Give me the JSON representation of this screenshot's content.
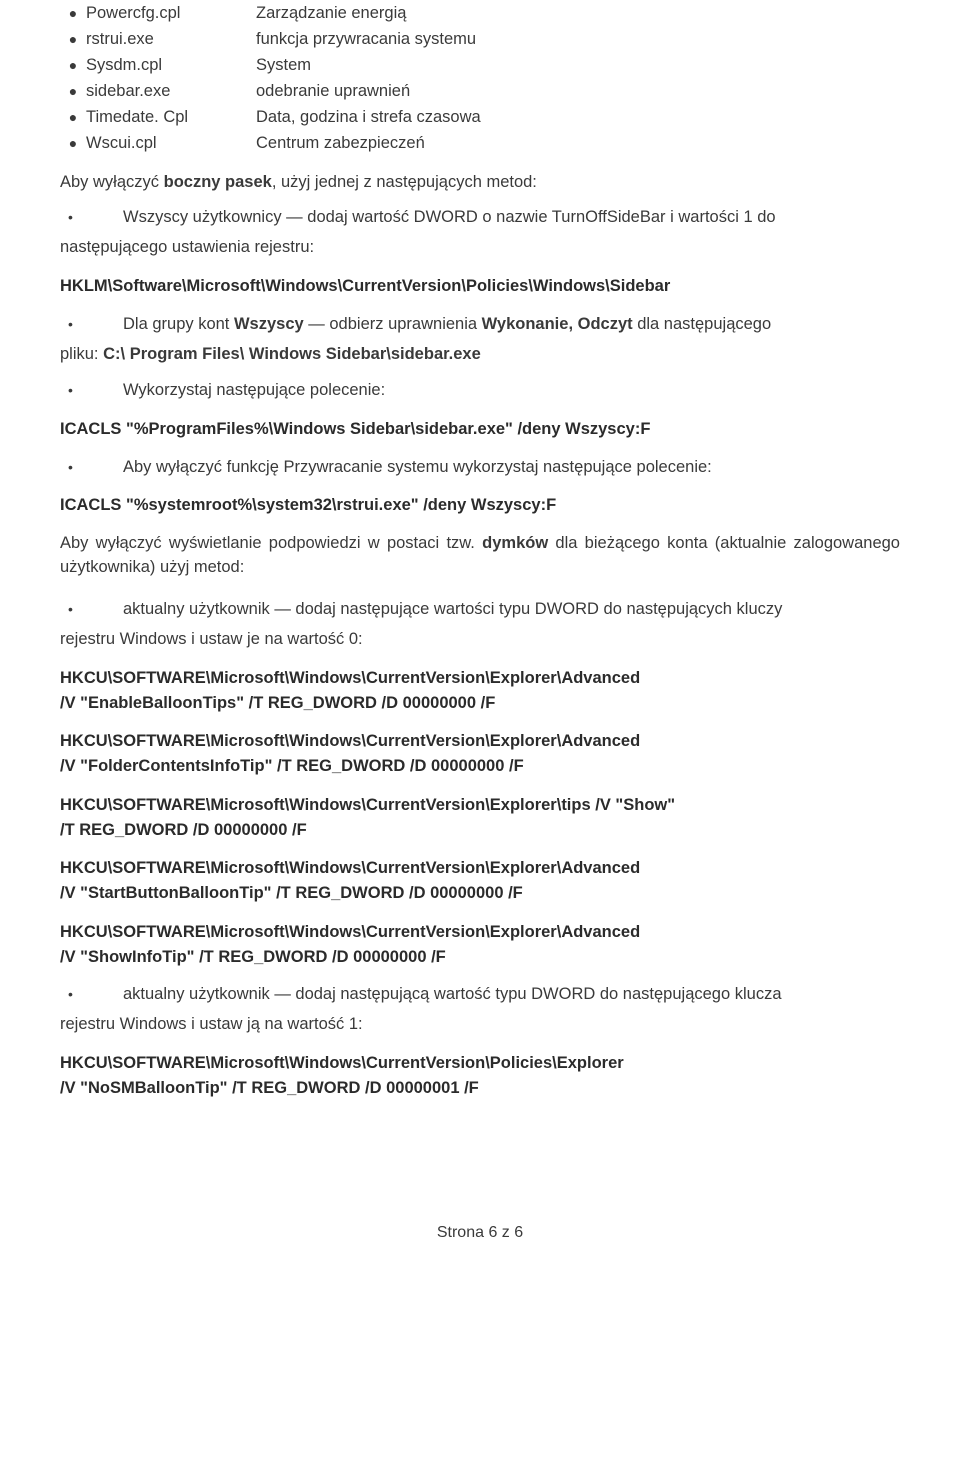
{
  "fileList": [
    {
      "cmd": "Powercfg.cpl",
      "desc": "Zarządzanie energią"
    },
    {
      "cmd": "rstrui.exe",
      "desc": "funkcja przywracania systemu"
    },
    {
      "cmd": "Sysdm.cpl",
      "desc": "System"
    },
    {
      "cmd": "sidebar.exe",
      "desc": "odebranie uprawnień"
    },
    {
      "cmd": "Timedate. Cpl",
      "desc": "Data, godzina i strefa czasowa"
    },
    {
      "cmd": "Wscui.cpl",
      "desc": "Centrum zabezpieczeń"
    }
  ],
  "p1": {
    "prefix": "Aby wyłączyć ",
    "bold1": "boczny pasek",
    "rest": ", użyj jednej z następujących metod:"
  },
  "sb1": {
    "prefix": "Wszyscy użytkownicy — dodaj wartość DWORD o nazwie TurnOffSideBar i wartości 1 do"
  },
  "p1b": "następującego ustawienia rejestru:",
  "reg1": "HKLM\\Software\\Microsoft\\Windows\\CurrentVersion\\Policies\\Windows\\Sidebar",
  "sb2": {
    "t1": "Dla grupy kont ",
    "b1": "Wszyscy",
    "t2": " — odbierz uprawnienia ",
    "b2": "Wykonanie, Odczyt",
    "t3": " dla następującego"
  },
  "p2b": {
    "t1": "pliku: ",
    "b1": "C:\\ Program Files\\ Windows Sidebar\\sidebar.exe"
  },
  "sb3": "Wykorzystaj następujące polecenie:",
  "cmd1": "ICACLS \"%ProgramFiles%\\Windows Sidebar\\sidebar.exe\" /deny Wszyscy:F",
  "sb4": "Aby wyłączyć funkcję Przywracanie systemu wykorzystaj następujące polecenie:",
  "cmd2": "ICACLS \"%systemroot%\\system32\\rstrui.exe\" /deny Wszyscy:F",
  "p3": {
    "t1": "Aby wyłączyć wyświetlanie podpowiedzi w postaci tzw. ",
    "b1": "dymków",
    "t2": " dla bieżącego konta (aktualnie zalogowanego użytkownika) użyj metod:"
  },
  "sb5": "aktualny użytkownik — dodaj następujące wartości typu DWORD do następujących kluczy",
  "p5b": "rejestru Windows i ustaw je na wartość 0:",
  "regBlocks": [
    {
      "l1": "HKCU\\SOFTWARE\\Microsoft\\Windows\\CurrentVersion\\Explorer\\Advanced",
      "l2": "/V \"EnableBalloonTips\" /T REG_DWORD /D 00000000 /F"
    },
    {
      "l1": "HKCU\\SOFTWARE\\Microsoft\\Windows\\CurrentVersion\\Explorer\\Advanced",
      "l2": "/V \"FolderContentsInfoTip\" /T REG_DWORD /D 00000000 /F"
    },
    {
      "l1": "HKCU\\SOFTWARE\\Microsoft\\Windows\\CurrentVersion\\Explorer\\tips /V \"Show\"",
      "l2": "/T REG_DWORD /D 00000000 /F"
    },
    {
      "l1": "HKCU\\SOFTWARE\\Microsoft\\Windows\\CurrentVersion\\Explorer\\Advanced",
      "l2": "/V \"StartButtonBalloonTip\" /T REG_DWORD /D 00000000 /F"
    },
    {
      "l1": "HKCU\\SOFTWARE\\Microsoft\\Windows\\CurrentVersion\\Explorer\\Advanced",
      "l2": "/V \"ShowInfoTip\" /T REG_DWORD /D 00000000 /F"
    }
  ],
  "sb6": "aktualny użytkownik — dodaj następującą wartość typu DWORD do następującego klucza",
  "p6b": "rejestru Windows i ustaw ją na wartość 1:",
  "regFinal": {
    "l1": "HKCU\\SOFTWARE\\Microsoft\\Windows\\CurrentVersion\\Policies\\Explorer",
    "l2": "/V \"NoSMBalloonTip\" /T REG_DWORD /D 00000001 /F"
  },
  "footer": "Strona 6 z 6"
}
